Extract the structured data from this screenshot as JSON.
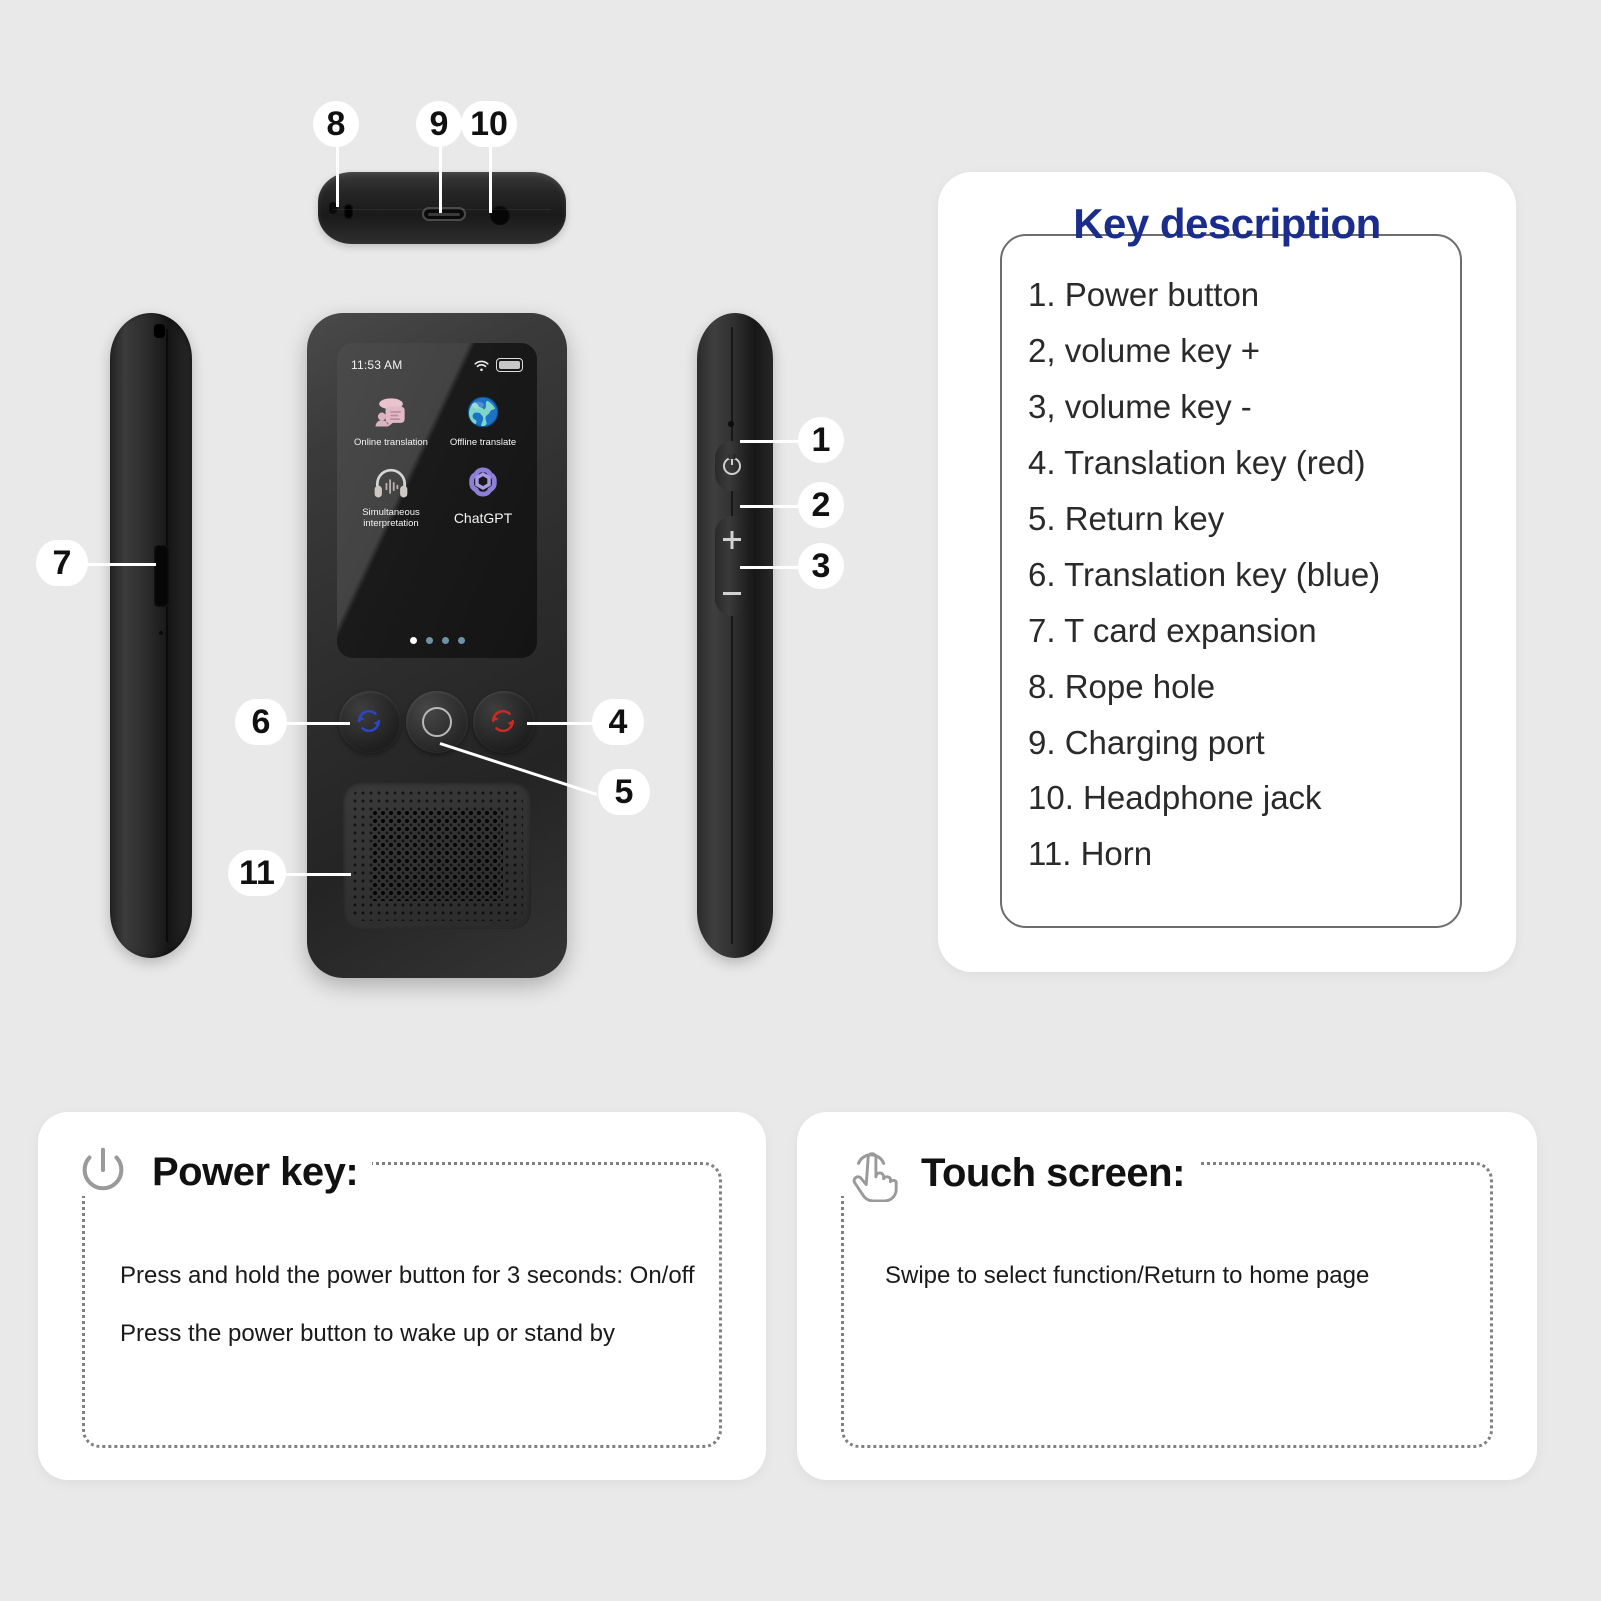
{
  "background_color": "#e9e9e9",
  "accent_color": "#1b2d8c",
  "device": {
    "views": {
      "top_edge": "bottom-edge-view",
      "left_side": "left-side-view",
      "front": "front-view",
      "right_side": "right-side-view"
    },
    "screen": {
      "time": "11:53 AM",
      "wifi_icon": "wifi-icon",
      "battery_icon": "battery-icon",
      "apps": [
        {
          "label": "Online translation",
          "icon": "online-translation-icon"
        },
        {
          "label": "Offline translate",
          "icon": "globe-icon"
        },
        {
          "label": "Simultaneous interpretation",
          "icon": "headphones-icon"
        },
        {
          "label": "ChatGPT",
          "icon": "chatgpt-icon"
        }
      ],
      "page_dots": {
        "total": 4,
        "active_index": 0
      }
    },
    "side_buttons": {
      "power_glyph": "power-icon",
      "volume_up_glyph": "+",
      "volume_down_glyph": "-"
    },
    "front_buttons": [
      {
        "name": "translation-key-blue",
        "color": "#2c46c8"
      },
      {
        "name": "return-key",
        "color": "#b9b9b9"
      },
      {
        "name": "translation-key-red",
        "color": "#cc2a22"
      }
    ]
  },
  "callouts": [
    {
      "number": "1",
      "target": "power-button"
    },
    {
      "number": "2",
      "target": "volume-up"
    },
    {
      "number": "3",
      "target": "volume-down"
    },
    {
      "number": "4",
      "target": "translation-key-red"
    },
    {
      "number": "5",
      "target": "return-key"
    },
    {
      "number": "6",
      "target": "translation-key-blue"
    },
    {
      "number": "7",
      "target": "t-card-slot"
    },
    {
      "number": "8",
      "target": "rope-hole"
    },
    {
      "number": "9",
      "target": "charging-port"
    },
    {
      "number": "10",
      "target": "headphone-jack"
    },
    {
      "number": "11",
      "target": "horn-speaker"
    }
  ],
  "key_description": {
    "title": "Key description",
    "items": [
      "1. Power button",
      "2, volume key +",
      "3, volume key -",
      "4. Translation key (red)",
      "5. Return key",
      "6. Translation key (blue)",
      "7. T card expansion",
      "8. Rope hole",
      "9. Charging port",
      "10. Headphone jack",
      "11. Horn"
    ]
  },
  "power_card": {
    "icon": "power-icon",
    "title": "Power key:",
    "lines": [
      "Press and hold the power button for 3 seconds: On/off",
      "Press the power button to wake up or stand by"
    ]
  },
  "touch_card": {
    "icon": "touch-hand-icon",
    "title": "Touch screen:",
    "lines": [
      "Swipe to select function/Return to home page"
    ]
  }
}
